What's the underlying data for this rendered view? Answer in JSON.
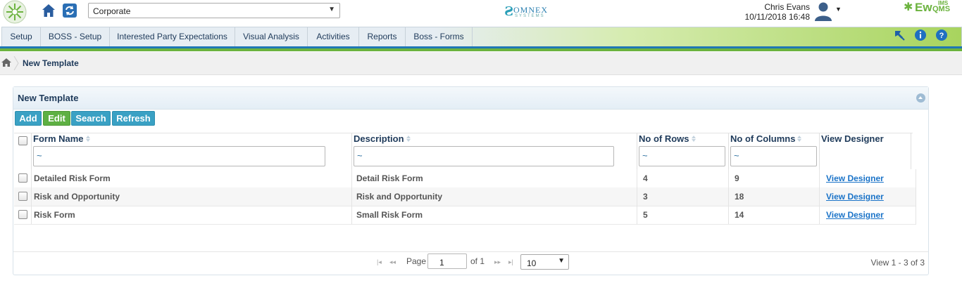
{
  "header": {
    "org_select_value": "Corporate",
    "brand_center": {
      "word": "OMNEX",
      "sub": "SYSTEMS"
    },
    "user_name": "Chris Evans",
    "user_datetime": "10/11/2018 16:48",
    "brand_right": {
      "ew": "Ew",
      "ims": "IMS",
      "qms": "QMS"
    }
  },
  "nav": {
    "items": [
      {
        "label": "Setup"
      },
      {
        "label": "BOSS - Setup"
      },
      {
        "label": "Interested Party Expectations"
      },
      {
        "label": "Visual Analysis"
      },
      {
        "label": "Activities"
      },
      {
        "label": "Reports"
      },
      {
        "label": "Boss - Forms"
      }
    ],
    "right_icons": [
      "pin-icon",
      "info-icon",
      "help-icon"
    ]
  },
  "breadcrumb": {
    "current": "New Template"
  },
  "panel": {
    "title": "New Template",
    "buttons": {
      "add": "Add",
      "edit": "Edit",
      "search": "Search",
      "refresh": "Refresh"
    },
    "columns": {
      "form_name": "Form Name",
      "description": "Description",
      "rows": "No of Rows",
      "cols": "No of Columns",
      "designer": "View Designer"
    },
    "filter_placeholder": "~",
    "rows": [
      {
        "form_name": "Detailed Risk Form",
        "description": "Detail Risk Form",
        "rows": "4",
        "cols": "9",
        "designer": "View Designer"
      },
      {
        "form_name": "Risk and Opportunity",
        "description": "Risk and Opportunity",
        "rows": "3",
        "cols": "18",
        "designer": "View Designer"
      },
      {
        "form_name": "Risk Form",
        "description": "Small Risk Form",
        "rows": "5",
        "cols": "14",
        "designer": "View Designer"
      }
    ],
    "pager": {
      "page_label": "Page",
      "page_value": "1",
      "of_label": "of 1",
      "page_size": "10",
      "view_text": "View 1 - 3 of 3"
    }
  },
  "colors": {
    "nav_blue": "#1f77b4",
    "nav_green": "#6cb33f",
    "button_blue": "#3aa1c4",
    "button_green": "#5eb043",
    "link": "#1a73c8"
  }
}
